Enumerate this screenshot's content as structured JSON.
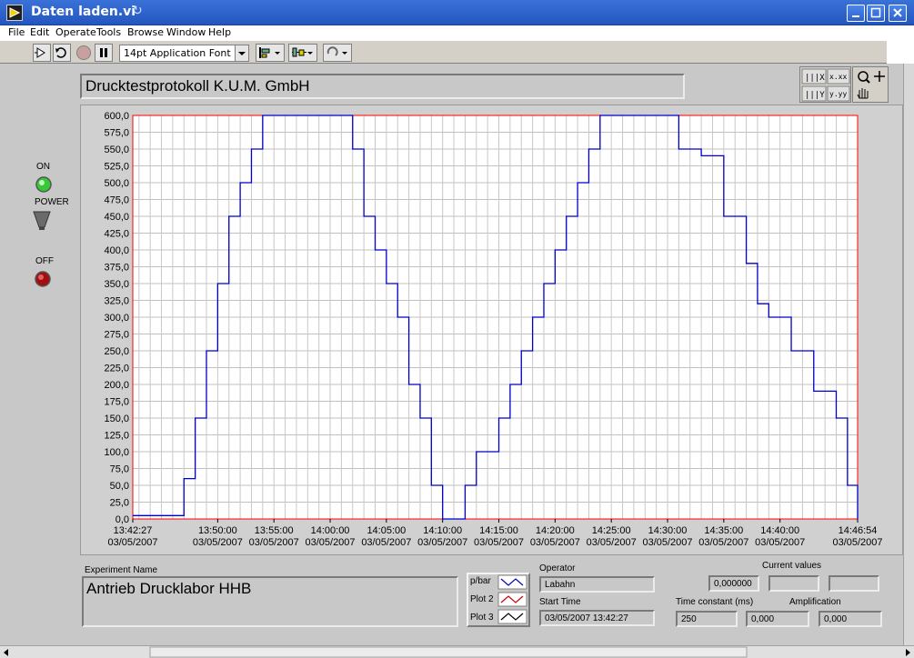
{
  "window": {
    "title": "Daten laden.vi"
  },
  "menu": [
    "File",
    "Edit",
    "Operate",
    "Tools",
    "Browse",
    "Window",
    "Help"
  ],
  "toolbar": {
    "font": "14pt Application Font"
  },
  "panel": {
    "title": "Drucktestprotokoll K.U.M. GmbH",
    "leds": {
      "on_label": "ON",
      "power_label": "POWER",
      "off_label": "OFF"
    }
  },
  "chart_data": {
    "type": "line",
    "series": [
      {
        "name": "p/bar",
        "color": "#0000c8",
        "x": [
          "13:42:27",
          "13:44:00",
          "13:46:00",
          "13:47:00",
          "13:48:00",
          "13:49:00",
          "13:50:00",
          "13:51:00",
          "13:52:00",
          "13:53:00",
          "13:54:00",
          "13:55:00",
          "13:57:00",
          "13:59:00",
          "14:01:00",
          "14:02:00",
          "14:03:00",
          "14:04:00",
          "14:05:00",
          "14:06:00",
          "14:07:00",
          "14:08:00",
          "14:09:00",
          "14:10:00",
          "14:11:00",
          "14:12:00",
          "14:13:00",
          "14:14:00",
          "14:15:00",
          "14:16:00",
          "14:17:00",
          "14:18:00",
          "14:19:00",
          "14:20:00",
          "14:21:00",
          "14:22:00",
          "14:23:00",
          "14:24:00",
          "14:26:00",
          "14:28:00",
          "14:30:00",
          "14:31:00",
          "14:33:00",
          "14:34:00",
          "14:35:00",
          "14:36:00",
          "14:37:00",
          "14:38:00",
          "14:39:00",
          "14:40:00",
          "14:41:00",
          "14:42:00",
          "14:43:00",
          "14:44:00",
          "14:45:00",
          "14:46:00",
          "14:46:54"
        ],
        "y": [
          5,
          5,
          5,
          60,
          150,
          250,
          350,
          450,
          500,
          550,
          600,
          600,
          600,
          600,
          600,
          550,
          450,
          400,
          350,
          300,
          200,
          150,
          50,
          0,
          0,
          50,
          100,
          100,
          150,
          200,
          250,
          300,
          350,
          400,
          450,
          500,
          550,
          600,
          600,
          600,
          600,
          550,
          540,
          540,
          450,
          450,
          380,
          320,
          300,
          300,
          250,
          250,
          190,
          190,
          150,
          50,
          0
        ]
      },
      {
        "name": "Plot 2",
        "color": "#cc0000",
        "x": [],
        "y": []
      },
      {
        "name": "Plot 3",
        "color": "#000000",
        "x": [],
        "y": []
      }
    ],
    "xlim": [
      "13:42:27",
      "14:46:54"
    ],
    "ylim": [
      0,
      600
    ],
    "yticks": [
      "0,0",
      "25,0",
      "50,0",
      "75,0",
      "100,0",
      "125,0",
      "150,0",
      "175,0",
      "200,0",
      "225,0",
      "250,0",
      "275,0",
      "300,0",
      "325,0",
      "350,0",
      "375,0",
      "400,0",
      "425,0",
      "450,0",
      "475,0",
      "500,0",
      "525,0",
      "550,0",
      "575,0",
      "600,0"
    ],
    "xticks": [
      {
        "time": "13:42:27",
        "date": "03/05/2007"
      },
      {
        "time": "13:50:00",
        "date": "03/05/2007"
      },
      {
        "time": "13:55:00",
        "date": "03/05/2007"
      },
      {
        "time": "14:00:00",
        "date": "03/05/2007"
      },
      {
        "time": "14:05:00",
        "date": "03/05/2007"
      },
      {
        "time": "14:10:00",
        "date": "03/05/2007"
      },
      {
        "time": "14:15:00",
        "date": "03/05/2007"
      },
      {
        "time": "14:20:00",
        "date": "03/05/2007"
      },
      {
        "time": "14:25:00",
        "date": "03/05/2007"
      },
      {
        "time": "14:30:00",
        "date": "03/05/2007"
      },
      {
        "time": "14:35:00",
        "date": "03/05/2007"
      },
      {
        "time": "14:40:00",
        "date": "03/05/2007"
      },
      {
        "time": "14:46:54",
        "date": "03/05/2007"
      }
    ],
    "grid": true,
    "legend": "bottom-center",
    "plot_background": "#ffffff",
    "axis_color": "#ff0000"
  },
  "experiment": {
    "label": "Experiment Name",
    "value": "Antrieb Drucklabor HHB"
  },
  "legend": [
    {
      "name": "p/bar",
      "color": "#0000c8"
    },
    {
      "name": "Plot 2",
      "color": "#cc0000"
    },
    {
      "name": "Plot 3",
      "color": "#000000"
    }
  ],
  "operator": {
    "label": "Operator",
    "value": "Labahn"
  },
  "start_time": {
    "label": "Start Time",
    "value": "03/05/2007 13:42:27"
  },
  "current_values": {
    "label": "Current values",
    "values": [
      "0,000000",
      "",
      ""
    ]
  },
  "time_constant": {
    "label": "Time constant (ms)",
    "value": "250"
  },
  "amplification": {
    "label": "Amplification",
    "values": [
      "0,000",
      "0,000"
    ]
  }
}
